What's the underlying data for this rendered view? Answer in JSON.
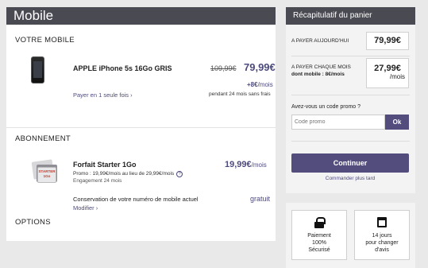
{
  "left": {
    "title": "Mobile",
    "mobile_section": {
      "heading": "VOTRE MOBILE",
      "product_name": "APPLE iPhone 5s 16Go GRIS",
      "old_price": "109,99€",
      "new_price": "79,99€",
      "monthly_amount": "+8€",
      "monthly_unit": "/mois",
      "pay_once_link": "Payer en 1 seule fois",
      "duration_note": "pendant 24 mois sans frais"
    },
    "plan_section": {
      "heading": "ABONNEMENT",
      "sim_label": "STARTER 1Go",
      "plan_name": "Forfait Starter 1Go",
      "promo_text": "Promo : 19,99€/mois au lieu de 29,99€/mois",
      "info_icon": "?",
      "engagement": "Engagement 24 mois",
      "plan_price": "19,99€",
      "plan_price_unit": "/mois",
      "keep_number": "Conservation de votre numéro de mobile actuel",
      "modify_link": "Modifier",
      "keep_price": "gratuit"
    },
    "options_heading": "OPTIONS"
  },
  "cart": {
    "title": "Récapitulatif du panier",
    "pay_today_label": "A PAYER AUJOURD'HUI",
    "pay_today_value": "79,99€",
    "pay_monthly_label": "A PAYER CHAQUE MOIS",
    "pay_monthly_sublabel": "dont mobile : 8€/mois",
    "pay_monthly_value": "27,99€",
    "pay_monthly_unit": "/mois",
    "promo_question": "Avez-vous un code promo ?",
    "promo_placeholder": "Code promo",
    "ok_label": "Ok",
    "continue_label": "Continuer",
    "order_later": "Commander plus tard"
  },
  "badges": [
    {
      "icon": "lock-icon",
      "lines": [
        "Paiement",
        "100%",
        "Sécurisé"
      ]
    },
    {
      "icon": "calendar-icon",
      "lines": [
        "14 jours",
        "pour changer",
        "d'avis"
      ]
    }
  ]
}
